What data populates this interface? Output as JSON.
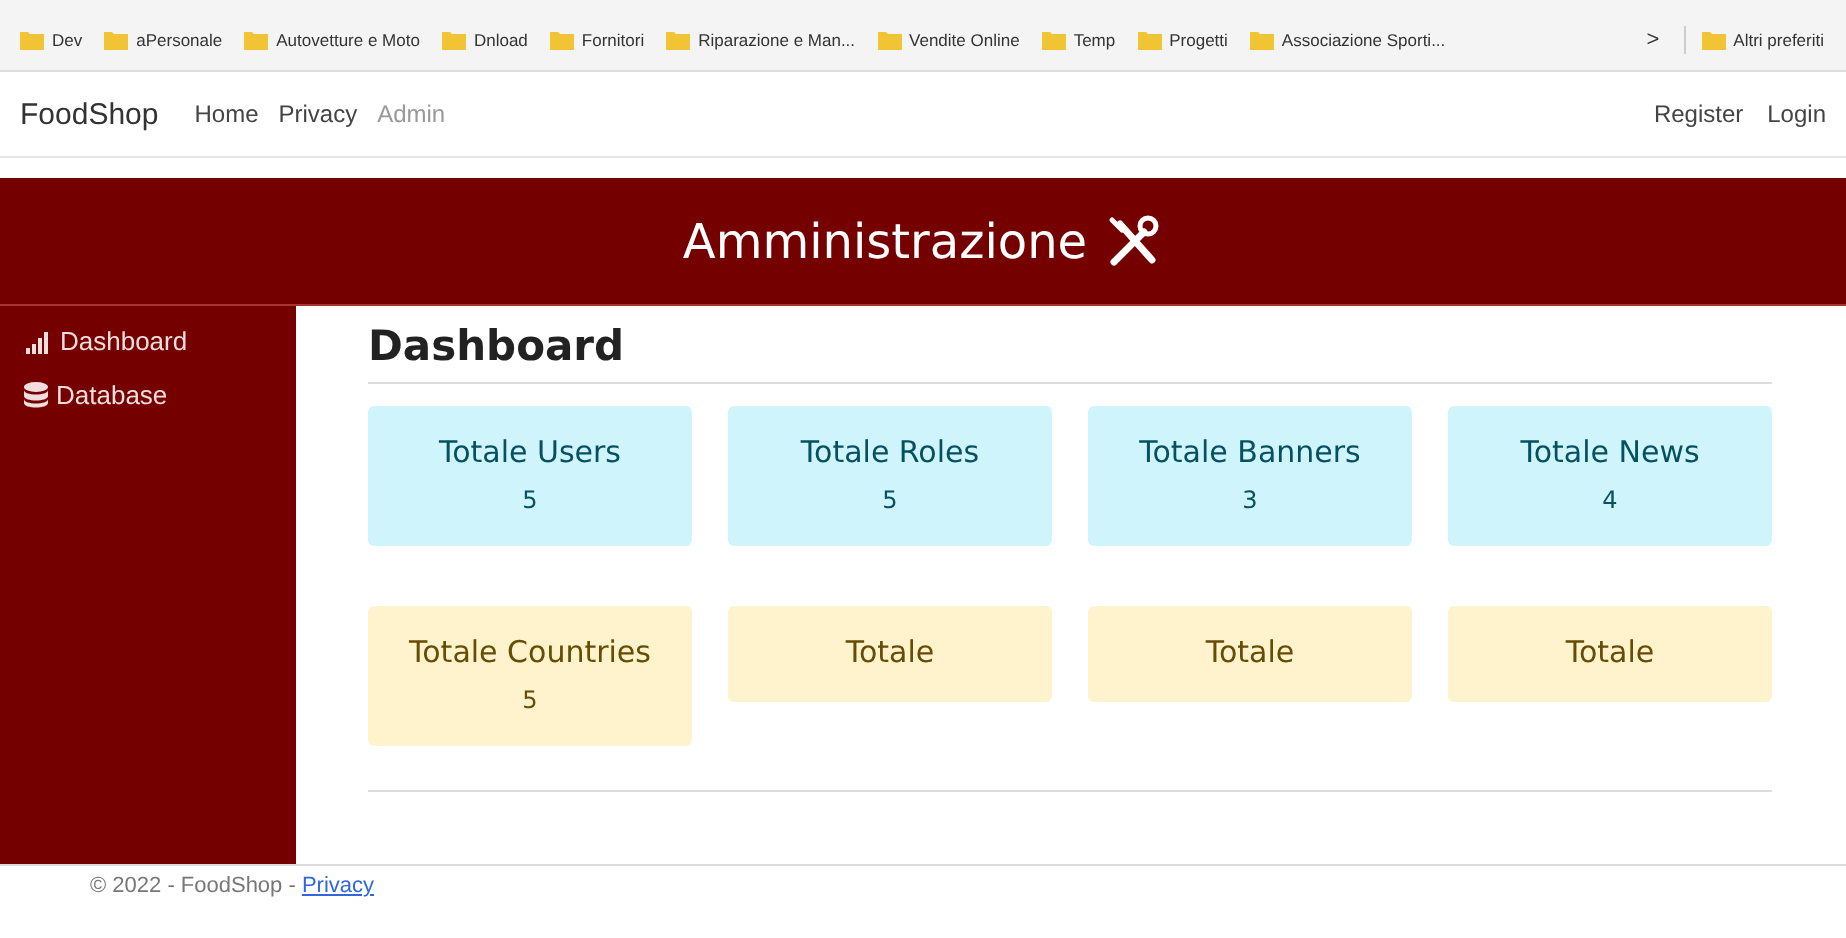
{
  "bookmarks": [
    {
      "label": "Dev"
    },
    {
      "label": "aPersonale"
    },
    {
      "label": "Autovetture e Moto"
    },
    {
      "label": "Dnload"
    },
    {
      "label": "Fornitori"
    },
    {
      "label": "Riparazione e Man..."
    },
    {
      "label": "Vendite Online"
    },
    {
      "label": "Temp"
    },
    {
      "label": "Progetti"
    },
    {
      "label": "Associazione Sporti..."
    }
  ],
  "bookmarks_more": ">",
  "bookmarks_other": "Altri preferiti",
  "navbar": {
    "brand": "FoodShop",
    "links": [
      {
        "label": "Home",
        "disabled": false
      },
      {
        "label": "Privacy",
        "disabled": false
      },
      {
        "label": "Admin",
        "disabled": true
      }
    ],
    "right_links": [
      {
        "label": "Register"
      },
      {
        "label": "Login"
      }
    ]
  },
  "header": {
    "title": "Amministrazione"
  },
  "sidebar": {
    "items": [
      {
        "label": "Dashboard",
        "kind": "chart"
      },
      {
        "label": "Database",
        "kind": "database"
      }
    ]
  },
  "page_title": "Dashboard",
  "cards": [
    {
      "title": "Totale Users",
      "count": "5",
      "kind": "info"
    },
    {
      "title": "Totale Roles",
      "count": "5",
      "kind": "info"
    },
    {
      "title": "Totale Banners",
      "count": "3",
      "kind": "info"
    },
    {
      "title": "Totale News",
      "count": "4",
      "kind": "info"
    },
    {
      "title": "Totale Countries",
      "count": "5",
      "kind": "warning"
    },
    {
      "title": "Totale",
      "kind": "warning"
    },
    {
      "title": "Totale",
      "kind": "warning"
    },
    {
      "title": "Totale",
      "kind": "warning"
    }
  ],
  "footer": {
    "text": "© 2022 - FoodShop - ",
    "link": "Privacy"
  }
}
